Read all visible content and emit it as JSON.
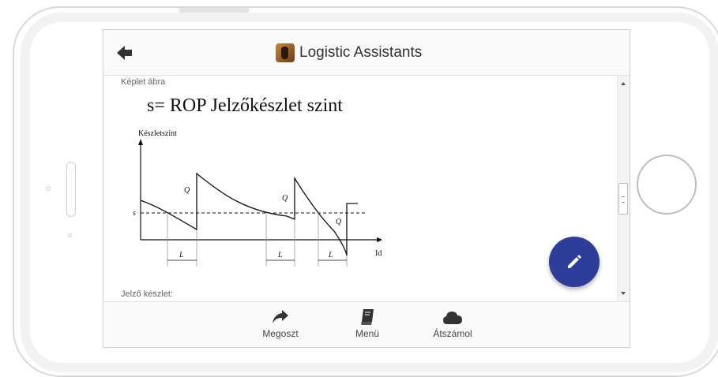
{
  "header": {
    "title": "Logistic Assistants",
    "back_icon": "arrow-left-icon",
    "logo_icon": "app-logo"
  },
  "content": {
    "section1_label": "Képlet ábra",
    "formula": "s= ROP Jelzőkészlet szint",
    "diagram": {
      "y_axis_label": "Készletszint",
      "x_axis_label": "Idő",
      "level_label": "s",
      "q_label": "Q",
      "lead_time_label": "L"
    },
    "section2_label": "Jelző készlet:"
  },
  "fab": {
    "icon": "pencil-icon"
  },
  "bottom_nav": {
    "items": [
      {
        "label": "Megoszt",
        "icon": "share-icon"
      },
      {
        "label": "Menü",
        "icon": "book-icon"
      },
      {
        "label": "Átszámol",
        "icon": "cloud-icon"
      }
    ]
  },
  "colors": {
    "accent": "#2e3c9a",
    "text": "#333333"
  }
}
